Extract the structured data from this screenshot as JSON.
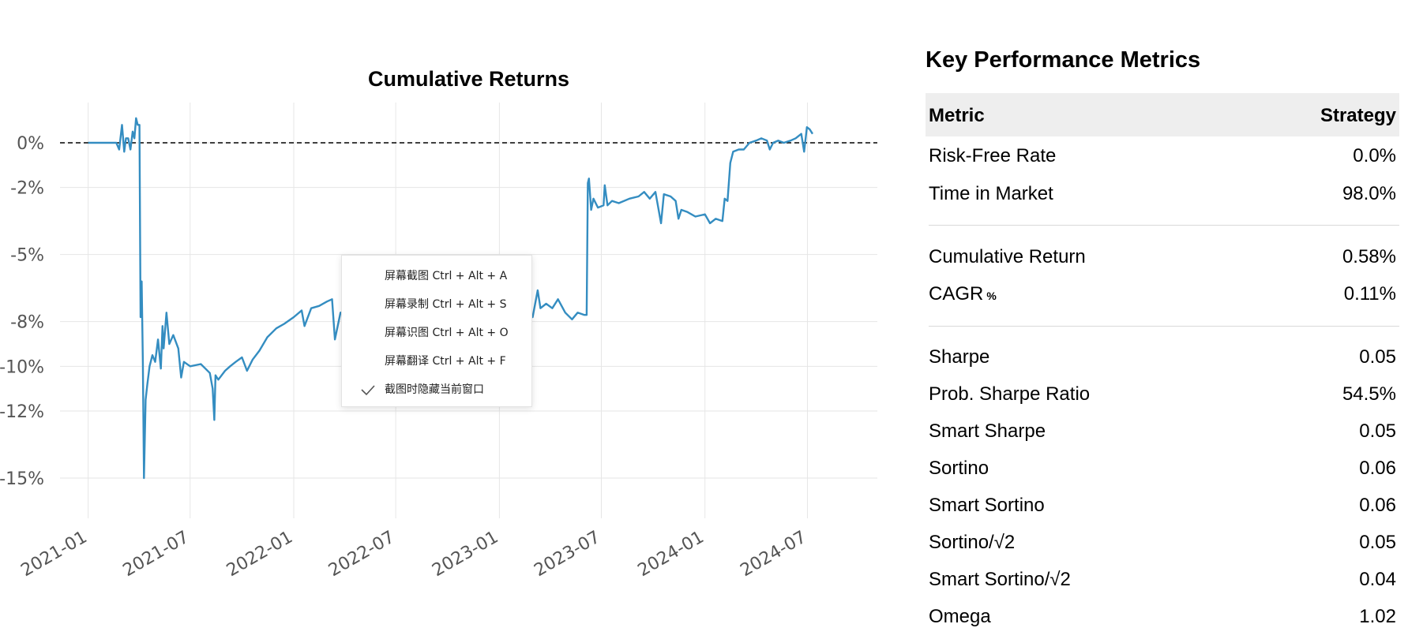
{
  "chart_data": {
    "type": "line",
    "title": "Cumulative Returns",
    "xlabel": "",
    "ylabel": "",
    "x_tick_labels": [
      "2021-01",
      "2021-07",
      "2022-01",
      "2022-07",
      "2023-01",
      "2023-07",
      "2024-01",
      "2024-07"
    ],
    "y_tick_labels": [
      "0%",
      "-2%",
      "-5%",
      "-8%",
      "-10%",
      "-12%",
      "-15%"
    ],
    "y_tick_values": [
      0,
      -2,
      -5,
      -8,
      -10,
      -12,
      -15
    ],
    "x_range": [
      "2020-11-12",
      "2024-11-02"
    ],
    "y_range": [
      -16.8,
      1.8
    ],
    "grid": true,
    "baseline": {
      "value": 0,
      "style": "dashed",
      "color": "#000000"
    },
    "series": [
      {
        "color": "#348dc1",
        "points": [
          [
            "2021-01-01",
            0
          ],
          [
            "2021-02-20",
            0
          ],
          [
            "2021-02-25",
            -0.3
          ],
          [
            "2021-03-02",
            0.8
          ],
          [
            "2021-03-06",
            -0.4
          ],
          [
            "2021-03-09",
            0.2
          ],
          [
            "2021-03-13",
            0.2
          ],
          [
            "2021-03-17",
            -0.3
          ],
          [
            "2021-03-21",
            0.5
          ],
          [
            "2021-03-24",
            0.2
          ],
          [
            "2021-03-27",
            1.1
          ],
          [
            "2021-03-30",
            0.8
          ],
          [
            "2021-04-02",
            0.8
          ],
          [
            "2021-04-03",
            -3.5
          ],
          [
            "2021-04-04",
            -7.8
          ],
          [
            "2021-04-06",
            -6.2
          ],
          [
            "2021-04-08",
            -9.8
          ],
          [
            "2021-04-10",
            -15.0
          ],
          [
            "2021-04-13",
            -11.5
          ],
          [
            "2021-04-16",
            -10.8
          ],
          [
            "2021-04-20",
            -10.0
          ],
          [
            "2021-04-25",
            -9.5
          ],
          [
            "2021-04-30",
            -9.8
          ],
          [
            "2021-05-05",
            -8.8
          ],
          [
            "2021-05-10",
            -10.1
          ],
          [
            "2021-05-13",
            -8.2
          ],
          [
            "2021-05-15",
            -9.2
          ],
          [
            "2021-05-20",
            -7.6
          ],
          [
            "2021-05-25",
            -9.0
          ],
          [
            "2021-06-01",
            -8.6
          ],
          [
            "2021-06-10",
            -9.2
          ],
          [
            "2021-06-15",
            -10.5
          ],
          [
            "2021-06-20",
            -9.8
          ],
          [
            "2021-07-01",
            -10.0
          ],
          [
            "2021-07-20",
            -9.9
          ],
          [
            "2021-08-05",
            -10.3
          ],
          [
            "2021-08-10",
            -11.0
          ],
          [
            "2021-08-13",
            -12.4
          ],
          [
            "2021-08-15",
            -10.4
          ],
          [
            "2021-08-20",
            -10.6
          ],
          [
            "2021-09-01",
            -10.2
          ],
          [
            "2021-09-10",
            -10.0
          ],
          [
            "2021-09-20",
            -9.8
          ],
          [
            "2021-10-01",
            -9.6
          ],
          [
            "2021-10-10",
            -10.2
          ],
          [
            "2021-10-20",
            -9.7
          ],
          [
            "2021-11-01",
            -9.3
          ],
          [
            "2021-11-15",
            -8.7
          ],
          [
            "2021-12-01",
            -8.3
          ],
          [
            "2021-12-15",
            -8.1
          ],
          [
            "2022-01-01",
            -7.8
          ],
          [
            "2022-01-15",
            -7.5
          ],
          [
            "2022-01-20",
            -8.2
          ],
          [
            "2022-02-01",
            -7.4
          ],
          [
            "2022-02-15",
            -7.3
          ],
          [
            "2022-03-01",
            -7.1
          ],
          [
            "2022-03-10",
            -7.0
          ],
          [
            "2022-03-15",
            -8.8
          ],
          [
            "2022-03-25",
            -7.6
          ],
          [
            "2022-04-10",
            -7.5
          ],
          [
            "2022-04-25",
            -7.4
          ],
          [
            "2022-05-10",
            -7.7
          ],
          [
            "2022-06-01",
            -7.6
          ],
          [
            "2022-06-20",
            -7.8
          ],
          [
            "2022-07-10",
            -7.9
          ],
          [
            "2022-08-01",
            -7.8
          ],
          [
            "2022-08-20",
            -7.5
          ],
          [
            "2022-09-10",
            -7.8
          ],
          [
            "2022-09-25",
            -8.0
          ],
          [
            "2022-10-10",
            -8.2
          ],
          [
            "2022-10-25",
            -8.5
          ],
          [
            "2022-11-10",
            -8.3
          ],
          [
            "2022-11-25",
            -8.6
          ],
          [
            "2022-12-10",
            -8.4
          ],
          [
            "2022-12-25",
            -8.3
          ],
          [
            "2023-01-10",
            -8.2
          ],
          [
            "2023-01-20",
            -8.5
          ],
          [
            "2023-02-01",
            -7.9
          ],
          [
            "2023-02-20",
            -7.6
          ],
          [
            "2023-03-01",
            -7.8
          ],
          [
            "2023-03-10",
            -6.6
          ],
          [
            "2023-03-15",
            -7.4
          ],
          [
            "2023-03-25",
            -7.2
          ],
          [
            "2023-04-05",
            -7.4
          ],
          [
            "2023-04-15",
            -7.0
          ],
          [
            "2023-04-28",
            -7.6
          ],
          [
            "2023-05-10",
            -7.9
          ],
          [
            "2023-05-20",
            -7.6
          ],
          [
            "2023-06-01",
            -7.7
          ],
          [
            "2023-06-05",
            -7.7
          ],
          [
            "2023-06-07",
            -1.8
          ],
          [
            "2023-06-09",
            -1.6
          ],
          [
            "2023-06-13",
            -3.0
          ],
          [
            "2023-06-17",
            -2.5
          ],
          [
            "2023-06-25",
            -2.9
          ],
          [
            "2023-07-05",
            -2.8
          ],
          [
            "2023-07-07",
            -1.9
          ],
          [
            "2023-07-12",
            -2.8
          ],
          [
            "2023-07-20",
            -2.6
          ],
          [
            "2023-08-01",
            -2.7
          ],
          [
            "2023-08-20",
            -2.5
          ],
          [
            "2023-09-05",
            -2.4
          ],
          [
            "2023-09-15",
            -2.2
          ],
          [
            "2023-09-25",
            -2.5
          ],
          [
            "2023-10-05",
            -2.2
          ],
          [
            "2023-10-15",
            -3.6
          ],
          [
            "2023-10-20",
            -2.3
          ],
          [
            "2023-11-01",
            -2.4
          ],
          [
            "2023-11-10",
            -2.6
          ],
          [
            "2023-11-15",
            -3.4
          ],
          [
            "2023-11-20",
            -3.0
          ],
          [
            "2023-12-01",
            -3.1
          ],
          [
            "2023-12-15",
            -3.3
          ],
          [
            "2024-01-01",
            -3.2
          ],
          [
            "2024-01-10",
            -3.6
          ],
          [
            "2024-01-20",
            -3.4
          ],
          [
            "2024-02-01",
            -3.5
          ],
          [
            "2024-02-05",
            -2.5
          ],
          [
            "2024-02-10",
            -2.6
          ],
          [
            "2024-02-15",
            -0.9
          ],
          [
            "2024-02-20",
            -0.4
          ],
          [
            "2024-03-01",
            -0.3
          ],
          [
            "2024-03-10",
            -0.3
          ],
          [
            "2024-03-20",
            0.0
          ],
          [
            "2024-04-01",
            0.1
          ],
          [
            "2024-04-10",
            0.2
          ],
          [
            "2024-04-20",
            0.1
          ],
          [
            "2024-04-25",
            -0.3
          ],
          [
            "2024-05-01",
            0.0
          ],
          [
            "2024-05-10",
            0.1
          ],
          [
            "2024-05-20",
            0.0
          ],
          [
            "2024-06-01",
            0.1
          ],
          [
            "2024-06-10",
            0.2
          ],
          [
            "2024-06-20",
            0.4
          ],
          [
            "2024-06-25",
            -0.4
          ],
          [
            "2024-06-30",
            0.7
          ],
          [
            "2024-07-05",
            0.6
          ],
          [
            "2024-07-10",
            0.4
          ]
        ]
      }
    ]
  },
  "context_menu": {
    "items": [
      {
        "label": "屏幕截图 Ctrl + Alt + A"
      },
      {
        "label": "屏幕录制 Ctrl + Alt + S"
      },
      {
        "label": "屏幕识图 Ctrl + Alt + O"
      },
      {
        "label": "屏幕翻译 Ctrl + Alt + F"
      },
      {
        "label": "截图时隐藏当前窗口",
        "checked": true
      }
    ]
  },
  "metrics": {
    "title": "Key Performance Metrics",
    "header": {
      "metric": "Metric",
      "strategy": "Strategy"
    },
    "groups": [
      [
        {
          "label": "Risk-Free Rate",
          "value": "0.0%"
        },
        {
          "label": "Time in Market",
          "value": "98.0%"
        }
      ],
      [
        {
          "label": "Cumulative Return",
          "value": "0.58%"
        },
        {
          "label": "CAGR",
          "suffix": "%",
          "value": "0.11%"
        }
      ],
      [
        {
          "label": "Sharpe",
          "value": "0.05"
        },
        {
          "label": "Prob. Sharpe Ratio",
          "value": "54.5%"
        },
        {
          "label": "Smart Sharpe",
          "value": "0.05"
        },
        {
          "label": "Sortino",
          "value": "0.06"
        },
        {
          "label": "Smart Sortino",
          "value": "0.06"
        },
        {
          "label": "Sortino/√2",
          "value": "0.05"
        },
        {
          "label": "Smart Sortino/√2",
          "value": "0.04"
        },
        {
          "label": "Omega",
          "value": "1.02"
        }
      ]
    ]
  }
}
